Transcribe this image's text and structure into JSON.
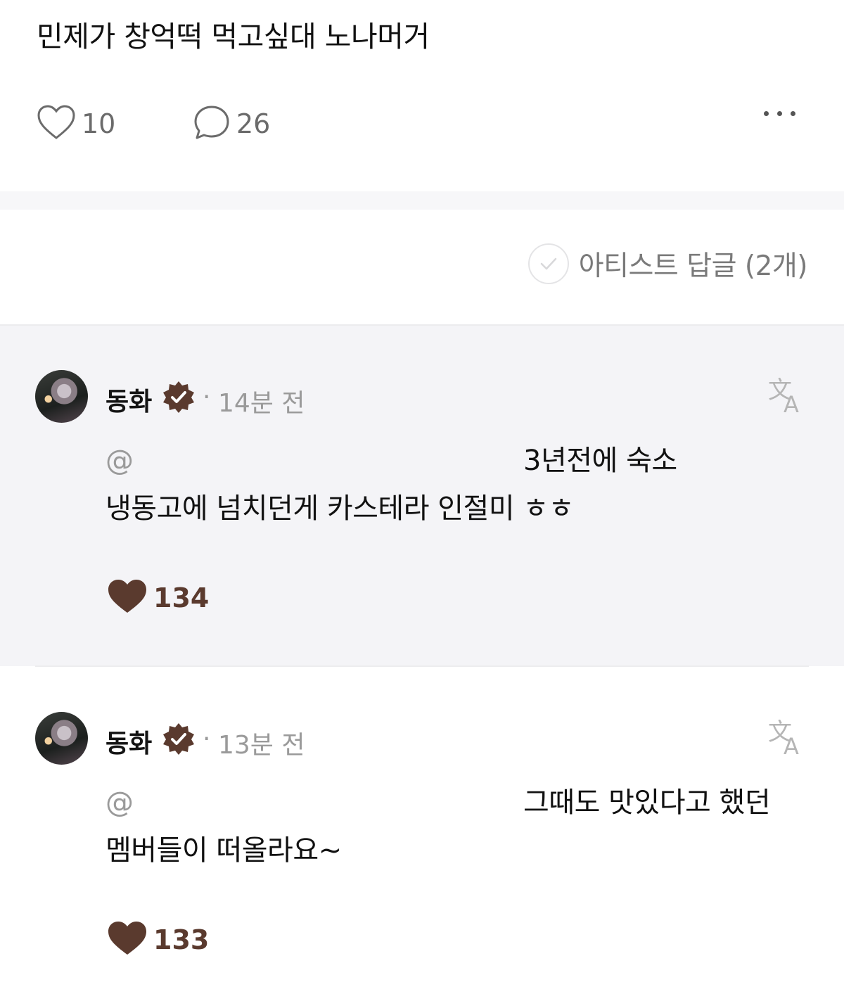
{
  "post": {
    "text": "민제가 창억떡 먹고싶대 노나머거",
    "like_count": "10",
    "comment_count": "26"
  },
  "filter": {
    "label": "아티스트 답글 (2개)"
  },
  "comments": [
    {
      "author": "동화",
      "separator": "·",
      "time": "14분 전",
      "mention": "@",
      "line1": "3년전에 숙소",
      "line2": "냉동고에 넘치던게 카스테라 인절미 ㅎㅎ",
      "likes": "134"
    },
    {
      "author": "동화",
      "separator": "·",
      "time": "13분 전",
      "mention": "@",
      "line1": "그때도 맛있다고 했던",
      "line2": "멤버들이 떠올라요~",
      "likes": "133"
    }
  ],
  "icons": {
    "like": "heart-outline-icon",
    "comment": "speech-bubble-icon",
    "more": "ellipsis-icon",
    "filter_check": "checkmark-circle-icon",
    "badge": "verified-badge-icon",
    "translate": "translate-icon",
    "comment_like": "heart-filled-icon"
  },
  "colors": {
    "brand_brown": "#5a3a2e",
    "comment_bg": "#f4f4f7",
    "muted_text": "#9a9a9a"
  }
}
